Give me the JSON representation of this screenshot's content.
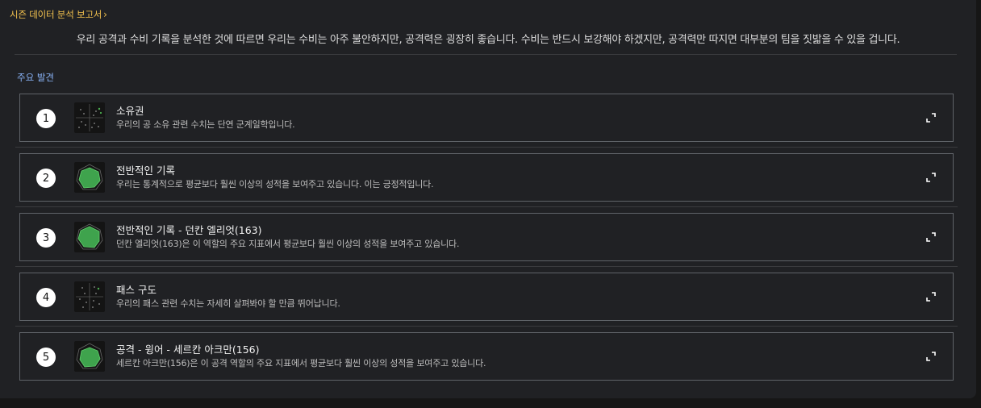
{
  "header": {
    "breadcrumb": "시즌 데이터 분석 보고서",
    "summary": "우리 공격과 수비 기록을 분석한 것에 따르면 우리는 수비는 아주 불안하지만, 공격력은 굉장히 좋습니다. 수비는 반드시 보강해야 하겠지만, 공격력만 따지면 대부분의 팀을 짓밟을 수 있을 겁니다."
  },
  "section": {
    "title": "주요 발견"
  },
  "findings": [
    {
      "number": "1",
      "icon": "scatter-plot-icon",
      "title": "소유권",
      "description": "우리의 공 소유 관련 수치는 단연 군계일학입니다."
    },
    {
      "number": "2",
      "icon": "radar-chart-icon",
      "title": "전반적인 기록",
      "description": "우리는 통계적으로 평균보다 훨씬 이상의 성적을 보여주고 있습니다. 이는 긍정적입니다."
    },
    {
      "number": "3",
      "icon": "radar-chart-icon",
      "title": "전반적인 기록 - 던칸 엘리엇(163)",
      "description": "던칸 엘리엇(163)은 이 역할의 주요 지표에서 평균보다 훨씬 이상의 성적을 보여주고 있습니다."
    },
    {
      "number": "4",
      "icon": "scatter-plot-icon",
      "title": "패스 구도",
      "description": "우리의 패스 관련 수치는 자세히 살펴봐야 할 만큼 뛰어납니다."
    },
    {
      "number": "5",
      "icon": "radar-chart-icon",
      "title": "공격 - 윙어 - 세르칸 아크만(156)",
      "description": "세르칸 아크만(156)은 이 공격 역할의 주요 지표에서 평균보다 훨씬 이상의 성적을 보여주고 있습니다."
    }
  ],
  "colors": {
    "accent_breadcrumb": "#f2c14e",
    "section_title": "#8ab4f8",
    "radar_fill": "#3fa34d"
  }
}
